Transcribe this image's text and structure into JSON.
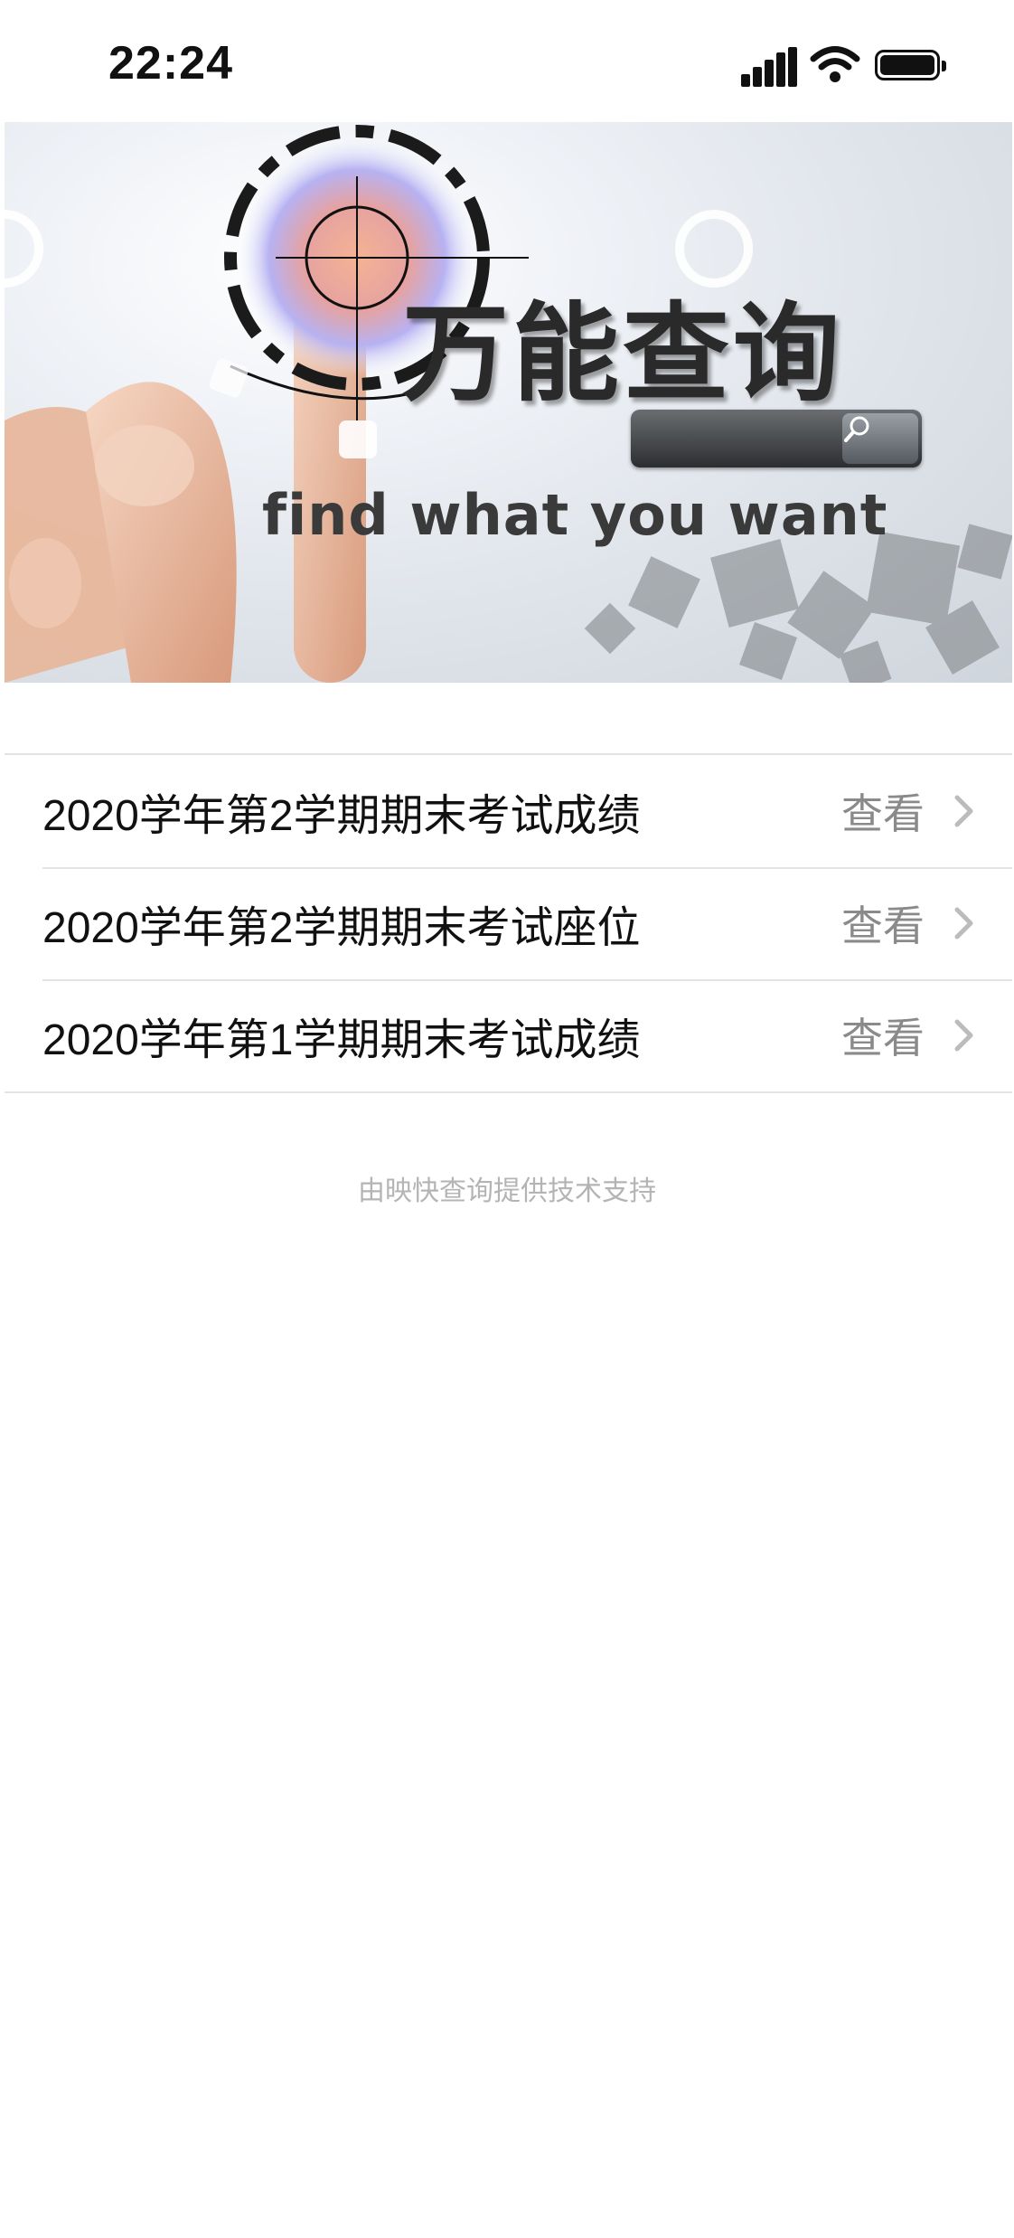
{
  "status_bar": {
    "time": "22:24"
  },
  "banner": {
    "title": "万能查询",
    "slogan": "find what you want"
  },
  "list": {
    "items": [
      {
        "title": "2020学年第2学期期末考试成绩",
        "action": "查看"
      },
      {
        "title": "2020学年第2学期期末考试座位",
        "action": "查看"
      },
      {
        "title": "2020学年第1学期期末考试成绩",
        "action": "查看"
      }
    ]
  },
  "footer": {
    "text": "由映快查询提供技术支持"
  },
  "icons": {
    "signal": "signal-icon",
    "wifi": "wifi-icon",
    "battery": "battery-icon",
    "search": "search-icon",
    "chevron": "chevron-right-icon"
  }
}
